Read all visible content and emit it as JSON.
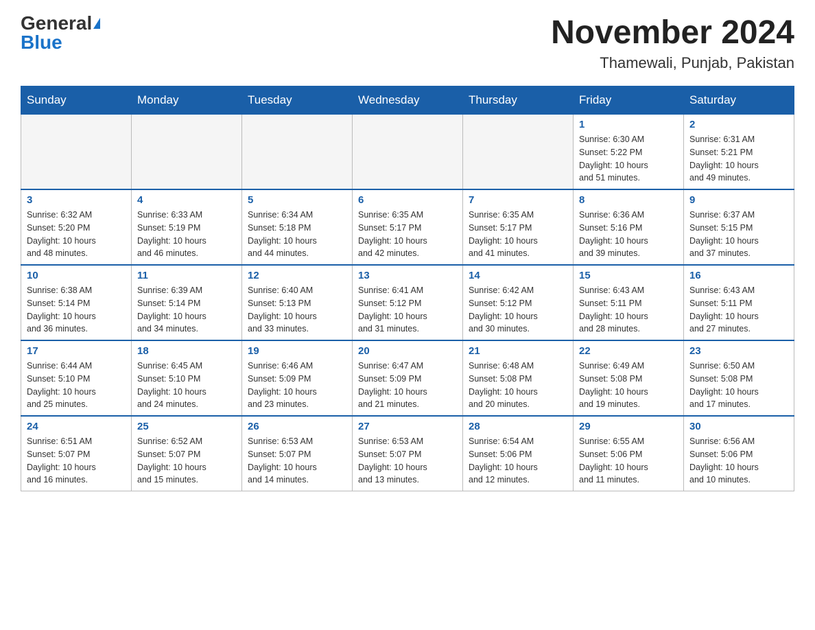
{
  "header": {
    "logo_general": "General",
    "logo_blue": "Blue",
    "month_title": "November 2024",
    "location": "Thamewali, Punjab, Pakistan"
  },
  "weekdays": [
    "Sunday",
    "Monday",
    "Tuesday",
    "Wednesday",
    "Thursday",
    "Friday",
    "Saturday"
  ],
  "weeks": [
    [
      {
        "day": "",
        "info": ""
      },
      {
        "day": "",
        "info": ""
      },
      {
        "day": "",
        "info": ""
      },
      {
        "day": "",
        "info": ""
      },
      {
        "day": "",
        "info": ""
      },
      {
        "day": "1",
        "info": "Sunrise: 6:30 AM\nSunset: 5:22 PM\nDaylight: 10 hours\nand 51 minutes."
      },
      {
        "day": "2",
        "info": "Sunrise: 6:31 AM\nSunset: 5:21 PM\nDaylight: 10 hours\nand 49 minutes."
      }
    ],
    [
      {
        "day": "3",
        "info": "Sunrise: 6:32 AM\nSunset: 5:20 PM\nDaylight: 10 hours\nand 48 minutes."
      },
      {
        "day": "4",
        "info": "Sunrise: 6:33 AM\nSunset: 5:19 PM\nDaylight: 10 hours\nand 46 minutes."
      },
      {
        "day": "5",
        "info": "Sunrise: 6:34 AM\nSunset: 5:18 PM\nDaylight: 10 hours\nand 44 minutes."
      },
      {
        "day": "6",
        "info": "Sunrise: 6:35 AM\nSunset: 5:17 PM\nDaylight: 10 hours\nand 42 minutes."
      },
      {
        "day": "7",
        "info": "Sunrise: 6:35 AM\nSunset: 5:17 PM\nDaylight: 10 hours\nand 41 minutes."
      },
      {
        "day": "8",
        "info": "Sunrise: 6:36 AM\nSunset: 5:16 PM\nDaylight: 10 hours\nand 39 minutes."
      },
      {
        "day": "9",
        "info": "Sunrise: 6:37 AM\nSunset: 5:15 PM\nDaylight: 10 hours\nand 37 minutes."
      }
    ],
    [
      {
        "day": "10",
        "info": "Sunrise: 6:38 AM\nSunset: 5:14 PM\nDaylight: 10 hours\nand 36 minutes."
      },
      {
        "day": "11",
        "info": "Sunrise: 6:39 AM\nSunset: 5:14 PM\nDaylight: 10 hours\nand 34 minutes."
      },
      {
        "day": "12",
        "info": "Sunrise: 6:40 AM\nSunset: 5:13 PM\nDaylight: 10 hours\nand 33 minutes."
      },
      {
        "day": "13",
        "info": "Sunrise: 6:41 AM\nSunset: 5:12 PM\nDaylight: 10 hours\nand 31 minutes."
      },
      {
        "day": "14",
        "info": "Sunrise: 6:42 AM\nSunset: 5:12 PM\nDaylight: 10 hours\nand 30 minutes."
      },
      {
        "day": "15",
        "info": "Sunrise: 6:43 AM\nSunset: 5:11 PM\nDaylight: 10 hours\nand 28 minutes."
      },
      {
        "day": "16",
        "info": "Sunrise: 6:43 AM\nSunset: 5:11 PM\nDaylight: 10 hours\nand 27 minutes."
      }
    ],
    [
      {
        "day": "17",
        "info": "Sunrise: 6:44 AM\nSunset: 5:10 PM\nDaylight: 10 hours\nand 25 minutes."
      },
      {
        "day": "18",
        "info": "Sunrise: 6:45 AM\nSunset: 5:10 PM\nDaylight: 10 hours\nand 24 minutes."
      },
      {
        "day": "19",
        "info": "Sunrise: 6:46 AM\nSunset: 5:09 PM\nDaylight: 10 hours\nand 23 minutes."
      },
      {
        "day": "20",
        "info": "Sunrise: 6:47 AM\nSunset: 5:09 PM\nDaylight: 10 hours\nand 21 minutes."
      },
      {
        "day": "21",
        "info": "Sunrise: 6:48 AM\nSunset: 5:08 PM\nDaylight: 10 hours\nand 20 minutes."
      },
      {
        "day": "22",
        "info": "Sunrise: 6:49 AM\nSunset: 5:08 PM\nDaylight: 10 hours\nand 19 minutes."
      },
      {
        "day": "23",
        "info": "Sunrise: 6:50 AM\nSunset: 5:08 PM\nDaylight: 10 hours\nand 17 minutes."
      }
    ],
    [
      {
        "day": "24",
        "info": "Sunrise: 6:51 AM\nSunset: 5:07 PM\nDaylight: 10 hours\nand 16 minutes."
      },
      {
        "day": "25",
        "info": "Sunrise: 6:52 AM\nSunset: 5:07 PM\nDaylight: 10 hours\nand 15 minutes."
      },
      {
        "day": "26",
        "info": "Sunrise: 6:53 AM\nSunset: 5:07 PM\nDaylight: 10 hours\nand 14 minutes."
      },
      {
        "day": "27",
        "info": "Sunrise: 6:53 AM\nSunset: 5:07 PM\nDaylight: 10 hours\nand 13 minutes."
      },
      {
        "day": "28",
        "info": "Sunrise: 6:54 AM\nSunset: 5:06 PM\nDaylight: 10 hours\nand 12 minutes."
      },
      {
        "day": "29",
        "info": "Sunrise: 6:55 AM\nSunset: 5:06 PM\nDaylight: 10 hours\nand 11 minutes."
      },
      {
        "day": "30",
        "info": "Sunrise: 6:56 AM\nSunset: 5:06 PM\nDaylight: 10 hours\nand 10 minutes."
      }
    ]
  ]
}
